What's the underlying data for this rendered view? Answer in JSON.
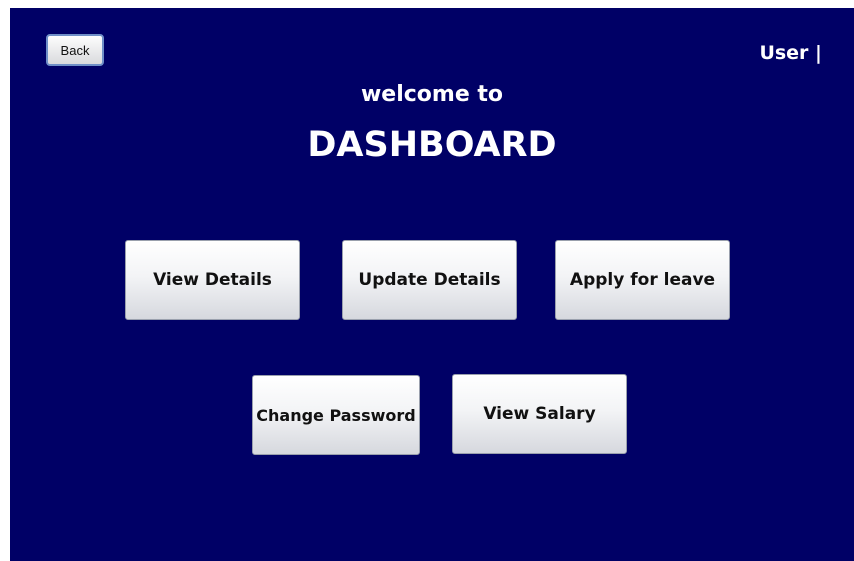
{
  "header": {
    "back_label": "Back",
    "user_label": "User |",
    "welcome": "welcome to",
    "title": "DASHBOARD"
  },
  "menu": {
    "view_details": "View Details",
    "update_details": "Update Details",
    "apply_leave": "Apply for leave",
    "change_password": "Change Password",
    "view_salary": "View Salary"
  },
  "colors": {
    "background": "#000066",
    "text": "#ffffff"
  }
}
